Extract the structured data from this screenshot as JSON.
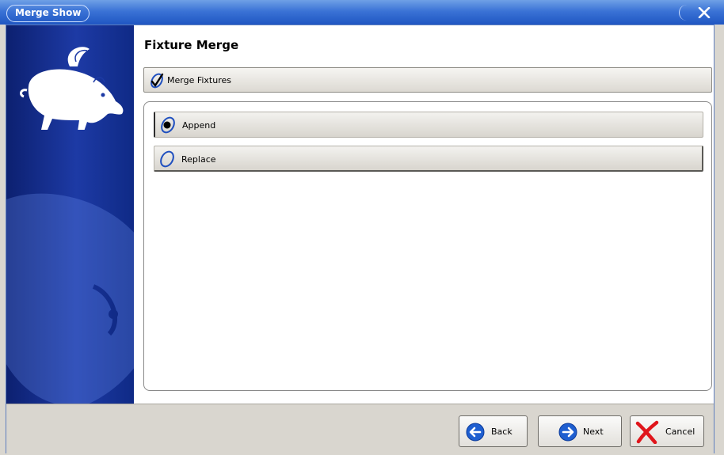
{
  "window": {
    "title": "Merge Show"
  },
  "page": {
    "title": "Fixture Merge"
  },
  "section": {
    "label": "Merge Fixtures"
  },
  "options": [
    {
      "label": "Append",
      "selected": true
    },
    {
      "label": "Replace",
      "selected": false
    }
  ],
  "buttons": {
    "back": "Back",
    "next": "Next",
    "cancel": "Cancel"
  },
  "colors": {
    "titlebar": "#2a62cf",
    "sidebar": "#1a349d",
    "accent": "#1f4fbf",
    "cancel": "#e0151b"
  }
}
